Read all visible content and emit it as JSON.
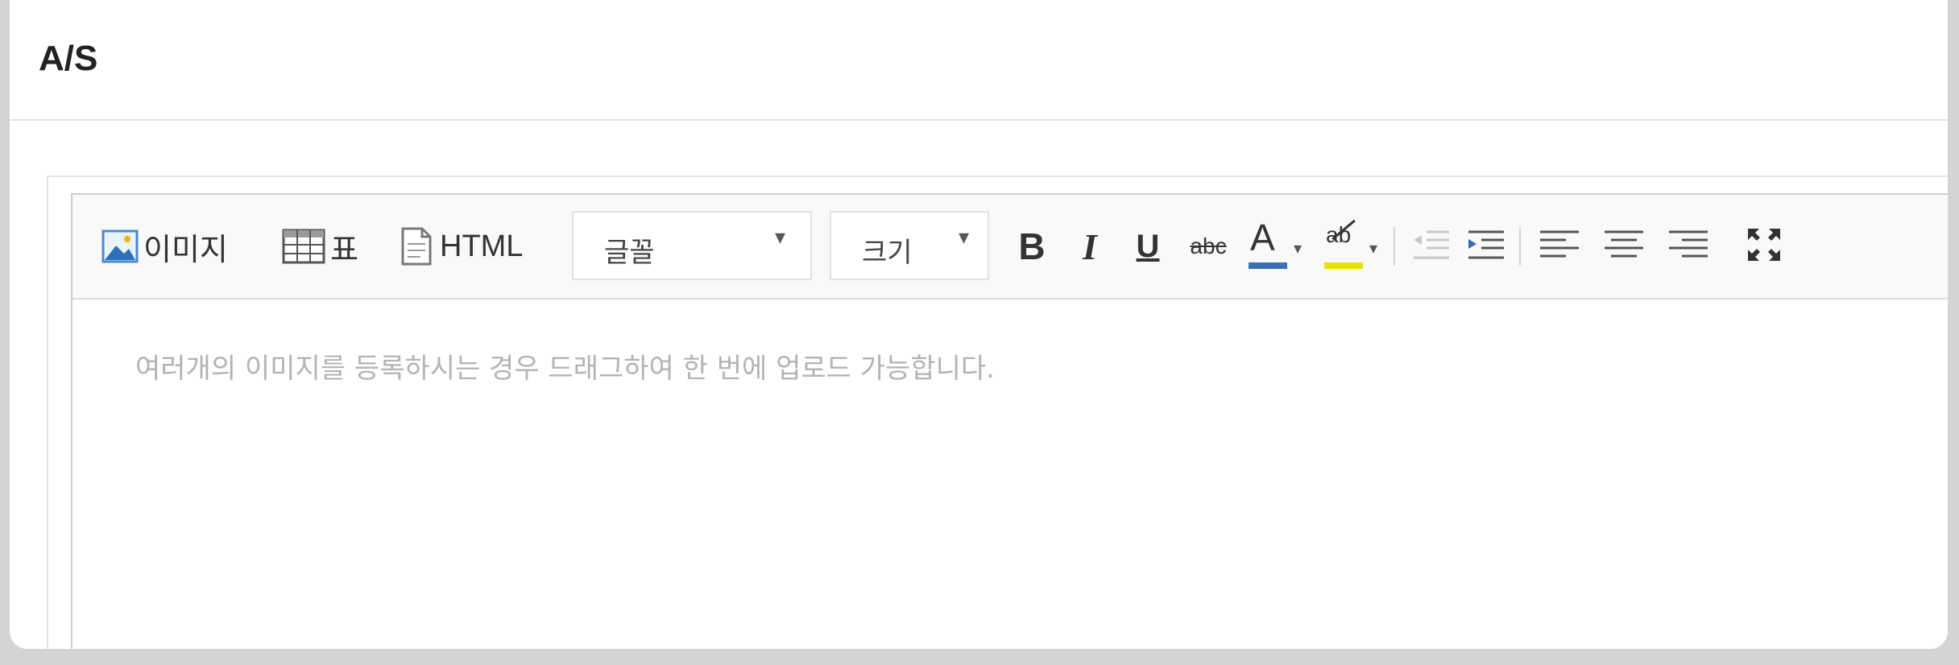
{
  "title": "A/S",
  "toolbar": {
    "image_label": "이미지",
    "table_label": "표",
    "html_label": "HTML",
    "font_select": "글꼴",
    "size_select": "크기",
    "bold": "B",
    "italic": "I",
    "underline": "U",
    "strike": "abc",
    "font_color": "A",
    "highlight": "ab"
  },
  "editor": {
    "placeholder": "여러개의 이미지를 등록하시는 경우 드래그하여 한 번에 업로드 가능합니다."
  },
  "colors": {
    "font_color_bar": "#3b6fb6",
    "highlight_bar": "#e8e000",
    "image_icon": "#3a7ac6"
  }
}
